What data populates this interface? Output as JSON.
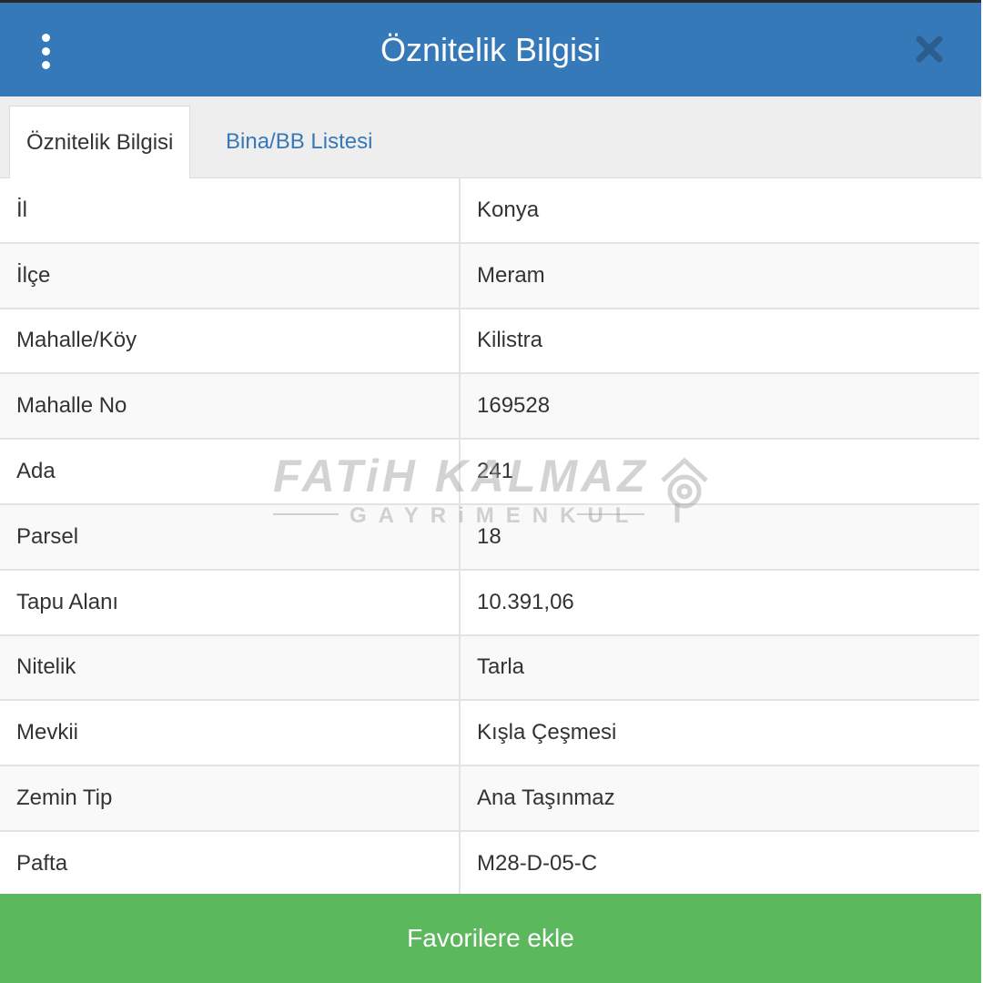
{
  "header": {
    "title": "Öznitelik Bilgisi"
  },
  "tabs": [
    {
      "label": "Öznitelik Bilgisi",
      "active": true
    },
    {
      "label": "Bina/BB Listesi",
      "active": false
    }
  ],
  "rows": [
    {
      "label": "İl",
      "value": "Konya"
    },
    {
      "label": "İlçe",
      "value": "Meram"
    },
    {
      "label": "Mahalle/Köy",
      "value": "Kilistra"
    },
    {
      "label": "Mahalle No",
      "value": "169528"
    },
    {
      "label": "Ada",
      "value": "241"
    },
    {
      "label": "Parsel",
      "value": "18"
    },
    {
      "label": "Tapu Alanı",
      "value": "10.391,06"
    },
    {
      "label": "Nitelik",
      "value": "Tarla"
    },
    {
      "label": "Mevkii",
      "value": "Kışla Çeşmesi"
    },
    {
      "label": "Zemin Tip",
      "value": "Ana Taşınmaz"
    },
    {
      "label": "Pafta",
      "value": "M28-D-05-C"
    }
  ],
  "watermark": {
    "line1": "FATiH KALMAZ",
    "line2": "GAYRiMENKUL"
  },
  "footer": {
    "button_label": "Favorilere ekle"
  },
  "colors": {
    "header": "#3579b8",
    "tab_link": "#3579b8",
    "footer_button": "#5cb85c"
  }
}
